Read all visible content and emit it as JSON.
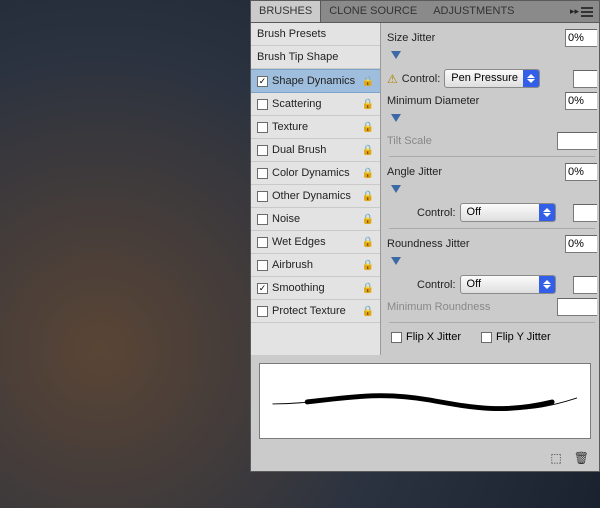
{
  "tabs": {
    "brushes": "BRUSHES",
    "cloneSource": "CLONE SOURCE",
    "adjustments": "ADJUSTMENTS"
  },
  "sidebar": {
    "brushPresets": "Brush Presets",
    "brushTipShape": "Brush Tip Shape",
    "items": [
      {
        "label": "Shape Dynamics",
        "checked": true,
        "selected": true
      },
      {
        "label": "Scattering",
        "checked": false,
        "selected": false
      },
      {
        "label": "Texture",
        "checked": false,
        "selected": false
      },
      {
        "label": "Dual Brush",
        "checked": false,
        "selected": false
      },
      {
        "label": "Color Dynamics",
        "checked": false,
        "selected": false
      },
      {
        "label": "Other Dynamics",
        "checked": false,
        "selected": false
      },
      {
        "label": "Noise",
        "checked": false,
        "selected": false
      },
      {
        "label": "Wet Edges",
        "checked": false,
        "selected": false
      },
      {
        "label": "Airbrush",
        "checked": false,
        "selected": false
      },
      {
        "label": "Smoothing",
        "checked": true,
        "selected": false
      },
      {
        "label": "Protect Texture",
        "checked": false,
        "selected": false
      }
    ]
  },
  "controls": {
    "sizeJitter": {
      "label": "Size Jitter",
      "value": "0%"
    },
    "sizeControl": {
      "label": "Control:",
      "value": "Pen Pressure"
    },
    "minDiameter": {
      "label": "Minimum Diameter",
      "value": "0%"
    },
    "tiltScale": {
      "label": "Tilt Scale",
      "value": ""
    },
    "angleJitter": {
      "label": "Angle Jitter",
      "value": "0%"
    },
    "angleControl": {
      "label": "Control:",
      "value": "Off"
    },
    "roundnessJitter": {
      "label": "Roundness Jitter",
      "value": "0%"
    },
    "roundnessControl": {
      "label": "Control:",
      "value": "Off"
    },
    "minRoundness": {
      "label": "Minimum Roundness",
      "value": ""
    },
    "flipX": "Flip X Jitter",
    "flipY": "Flip Y Jitter"
  }
}
